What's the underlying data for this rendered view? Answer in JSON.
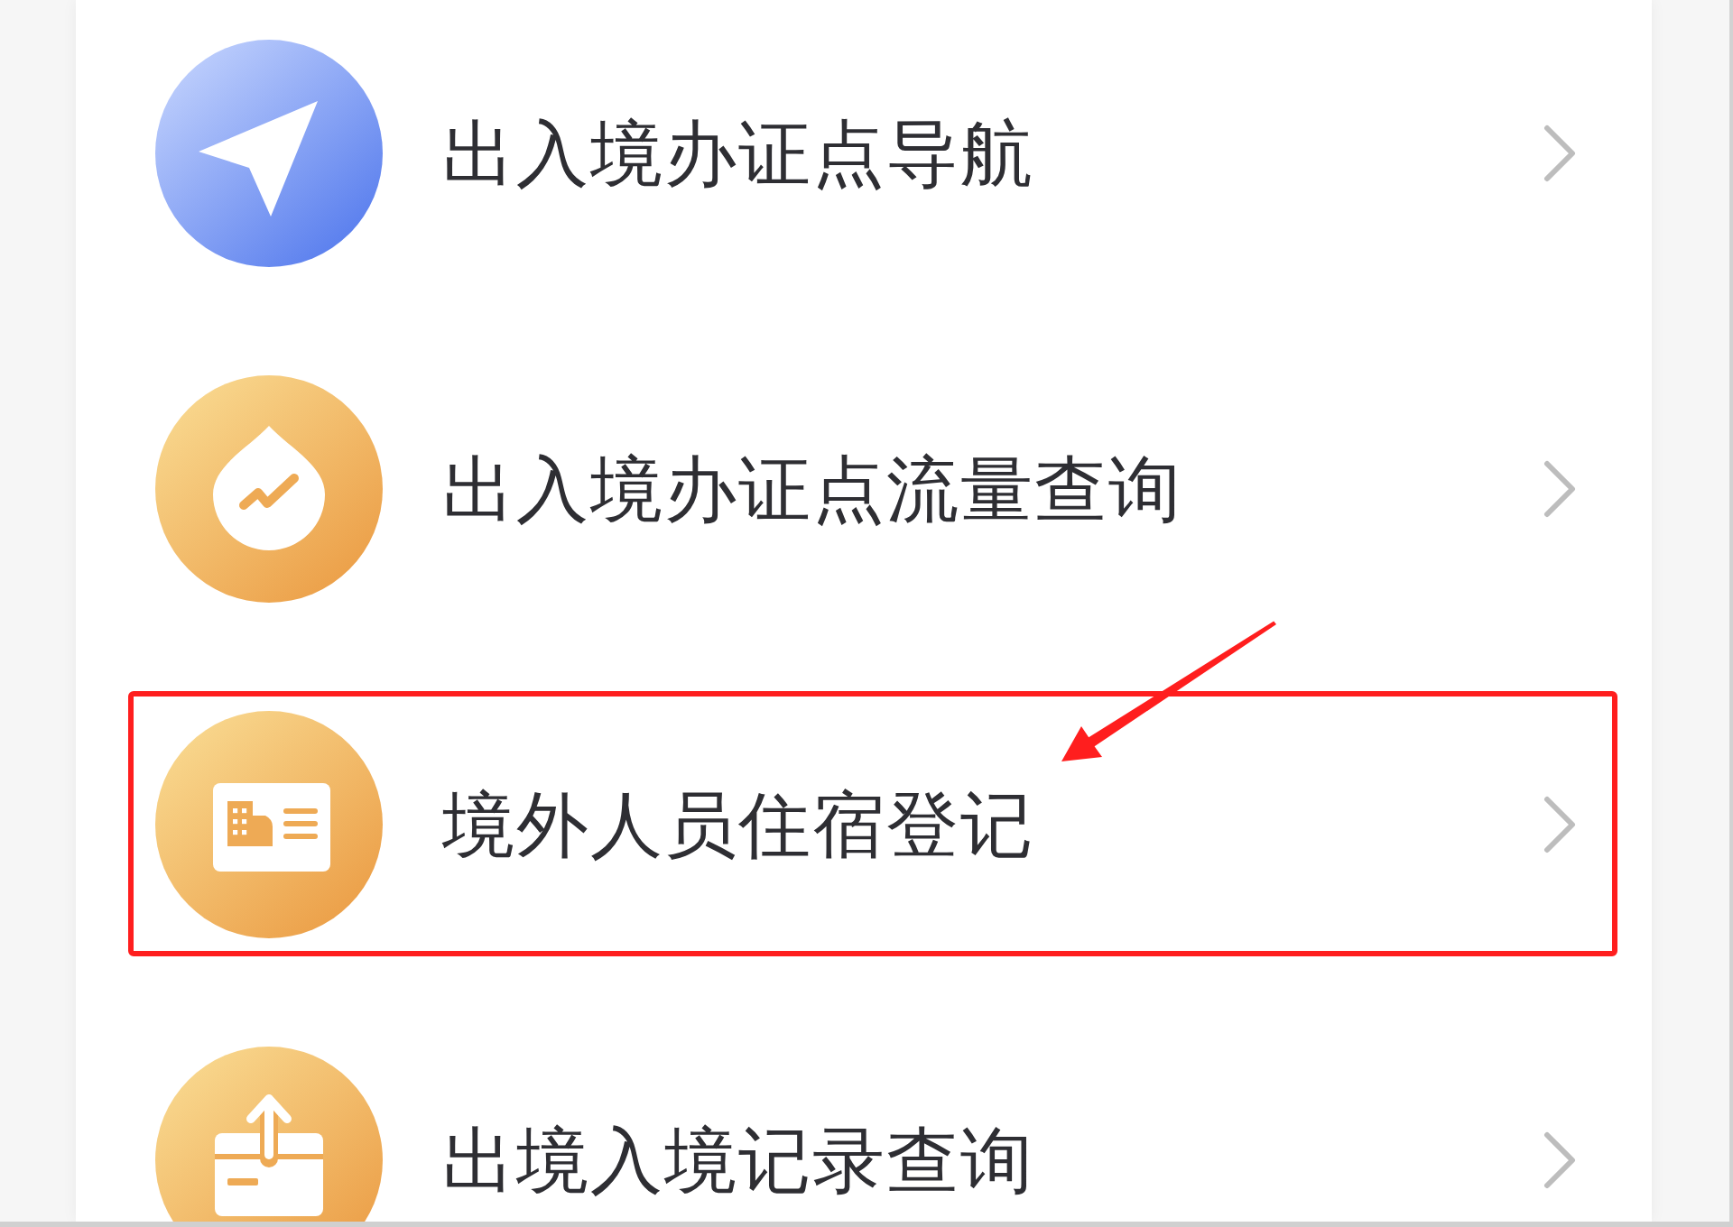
{
  "items": [
    {
      "kind": "navigation",
      "label": "出入境办证点导航",
      "highlighted": false
    },
    {
      "kind": "traffic",
      "label": "出入境办证点流量查询",
      "highlighted": false
    },
    {
      "kind": "lodging",
      "label": "境外人员住宿登记",
      "highlighted": true
    },
    {
      "kind": "records",
      "label": "出境入境记录查询",
      "highlighted": false
    }
  ]
}
